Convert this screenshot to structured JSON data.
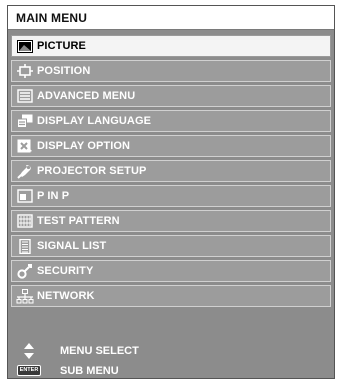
{
  "menu": {
    "title": "MAIN MENU",
    "items": [
      {
        "label": "PICTURE",
        "icon": "picture-icon",
        "selected": true
      },
      {
        "label": "POSITION",
        "icon": "position-icon",
        "selected": false
      },
      {
        "label": "ADVANCED MENU",
        "icon": "advanced-menu-icon",
        "selected": false
      },
      {
        "label": "DISPLAY LANGUAGE",
        "icon": "display-language-icon",
        "selected": false
      },
      {
        "label": "DISPLAY OPTION",
        "icon": "display-option-icon",
        "selected": false
      },
      {
        "label": "PROJECTOR SETUP",
        "icon": "projector-setup-icon",
        "selected": false
      },
      {
        "label": "P IN P",
        "icon": "p-in-p-icon",
        "selected": false
      },
      {
        "label": "TEST PATTERN",
        "icon": "test-pattern-icon",
        "selected": false
      },
      {
        "label": "SIGNAL LIST",
        "icon": "signal-list-icon",
        "selected": false
      },
      {
        "label": "SECURITY",
        "icon": "security-key-icon",
        "selected": false
      },
      {
        "label": "NETWORK",
        "icon": "network-icon",
        "selected": false
      }
    ]
  },
  "footer": {
    "menu_select": "MENU SELECT",
    "sub_menu": "SUB MENU",
    "enter_key": "ENTER"
  },
  "colors": {
    "panel": "#8c8c8c",
    "item": "#9c9c9c",
    "selected_item": "#f4f4f4",
    "text": "#ffffff"
  }
}
